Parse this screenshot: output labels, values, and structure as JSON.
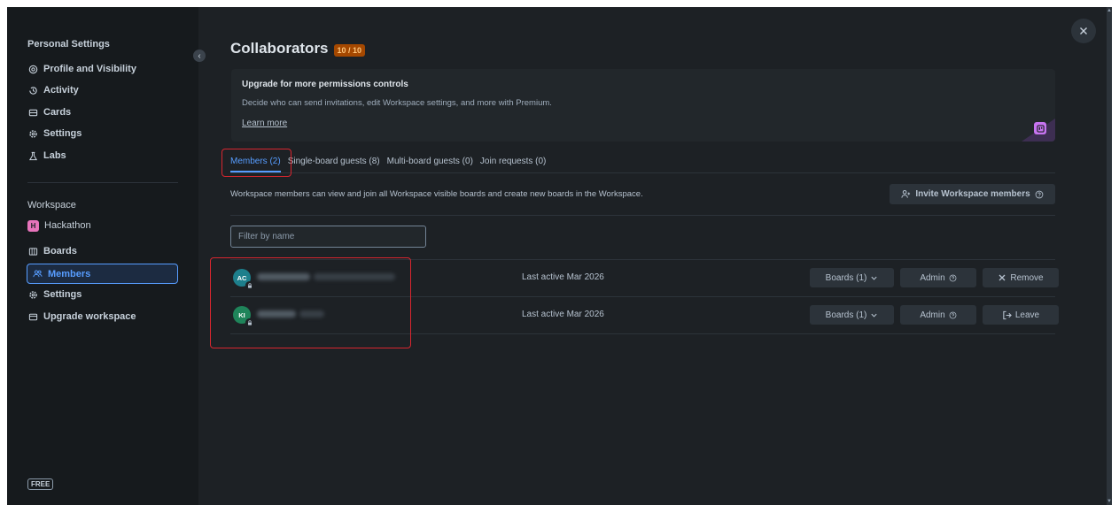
{
  "sidebar": {
    "personal_heading": "Personal Settings",
    "personal_items": [
      {
        "label": "Profile and Visibility",
        "icon": "at-icon"
      },
      {
        "label": "Activity",
        "icon": "history-icon"
      },
      {
        "label": "Cards",
        "icon": "card-icon"
      },
      {
        "label": "Settings",
        "icon": "gear-icon"
      },
      {
        "label": "Labs",
        "icon": "labs-icon"
      }
    ],
    "workspace_heading": "Workspace",
    "workspace_name": "Hackathon",
    "workspace_initial": "H",
    "workspace_items": [
      {
        "label": "Boards",
        "icon": "boards-icon"
      },
      {
        "label": "Members",
        "icon": "members-icon"
      },
      {
        "label": "Settings",
        "icon": "gear-icon"
      },
      {
        "label": "Upgrade workspace",
        "icon": "upgrade-card-icon"
      }
    ],
    "plan_badge": "FREE"
  },
  "header": {
    "title": "Collaborators",
    "count_badge": "10 / 10"
  },
  "upgrade": {
    "title": "Upgrade for more permissions controls",
    "description": "Decide who can send invitations, edit Workspace settings, and more with Premium.",
    "link": "Learn more"
  },
  "tabs": [
    {
      "label": "Members (2)",
      "active": true
    },
    {
      "label": "Single-board guests (8)",
      "active": false
    },
    {
      "label": "Multi-board guests (0)",
      "active": false
    },
    {
      "label": "Join requests (0)",
      "active": false
    }
  ],
  "members_section": {
    "description": "Workspace members can view and join all Workspace visible boards and create new boards in the Workspace.",
    "invite_label": "Invite Workspace members",
    "filter_placeholder": "Filter by name"
  },
  "members": [
    {
      "initials": "AC",
      "avatar_color": "#1d7f8c",
      "last_active": "Last active Mar 2026",
      "boards_label": "Boards (1)",
      "role_label": "Admin",
      "action_label": "Remove",
      "action_icon": "close-icon"
    },
    {
      "initials": "KI",
      "avatar_color": "#1f845a",
      "last_active": "Last active Mar 2026",
      "boards_label": "Boards (1)",
      "role_label": "Admin",
      "action_label": "Leave",
      "action_icon": "leave-icon"
    }
  ],
  "colors": {
    "background": "#1d2125",
    "sidebar": "#161a1d",
    "accent": "#579dff",
    "highlight_box": "#d8262f",
    "count_badge": "#a54800"
  }
}
